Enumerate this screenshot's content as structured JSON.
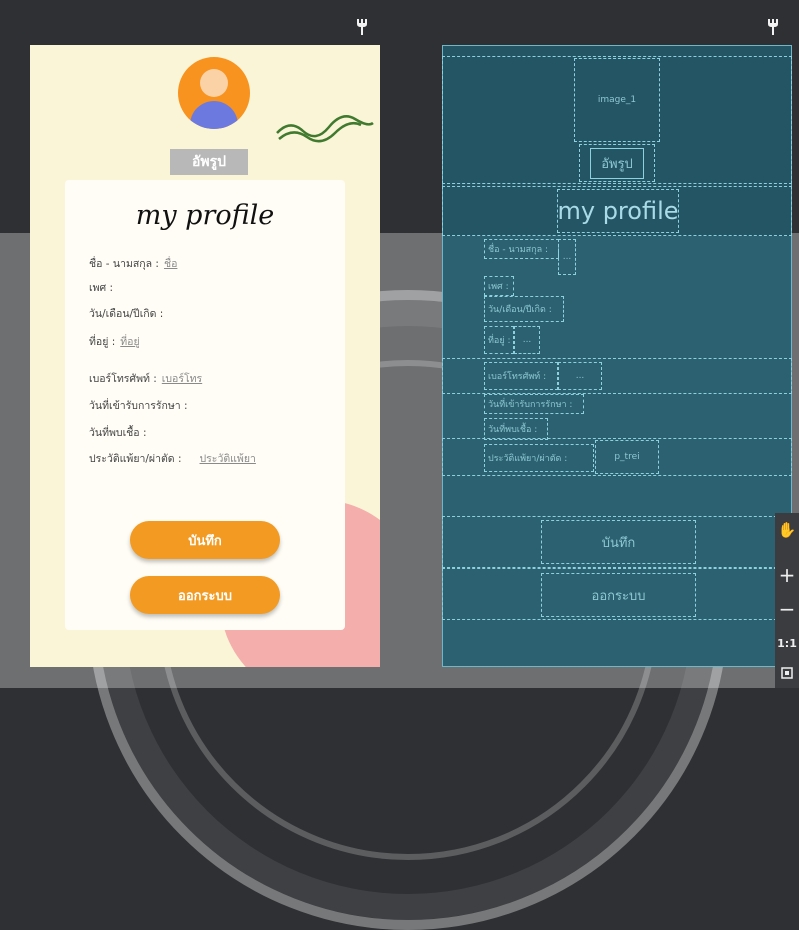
{
  "toolbar": {
    "design_icon": "wrench-icon",
    "blueprint_icon": "wrench-icon"
  },
  "design": {
    "upload_button": "อัพรูป",
    "title": "my profile",
    "fields": [
      {
        "label": "ชื่อ - นามสกุล :",
        "value": "ชื่อ"
      },
      {
        "label": "เพศ :",
        "value": ""
      },
      {
        "label": "วัน/เดือน/ปีเกิด :",
        "value": ""
      },
      {
        "label": "ที่อยู่ :",
        "value": "ที่อยู่"
      },
      {
        "label": "เบอร์โทรศัพท์ :",
        "value": "เบอร์โทร"
      },
      {
        "label": "วันที่เข้ารับการรักษา :",
        "value": ""
      },
      {
        "label": "วันที่พบเชื้อ :",
        "value": ""
      },
      {
        "label": "ประวัติแพ้ยา/ผ่าตัด :",
        "value": "ประวัติแพ้ยา"
      }
    ],
    "save_button": "บันทึก",
    "logout_button": "ออกระบบ"
  },
  "blueprint": {
    "image_label": "image_1",
    "upload_button": "อัพรูป",
    "title": "my profile",
    "labels": [
      "ชื่อ - นามสกุล :",
      "เพศ :",
      "วัน/เดือน/ปีเกิด :",
      "ที่อยู่ :",
      "เบอร์โทรศัพท์ :",
      "วันที่เข้ารับการรักษา :",
      "วันที่พบเชื้อ :",
      "ประวัติแพ้ยา/ผ่าตัด :"
    ],
    "value_placeholder": "...",
    "textbox_label": "p_trei",
    "save_button": "บันทึก",
    "logout_button": "ออกระบบ"
  },
  "tools": {
    "zoom_ratio": "1:1"
  },
  "colors": {
    "accent": "#f29a21",
    "blueprint": "#2b6170",
    "design_bg": "#fbf5d8"
  }
}
